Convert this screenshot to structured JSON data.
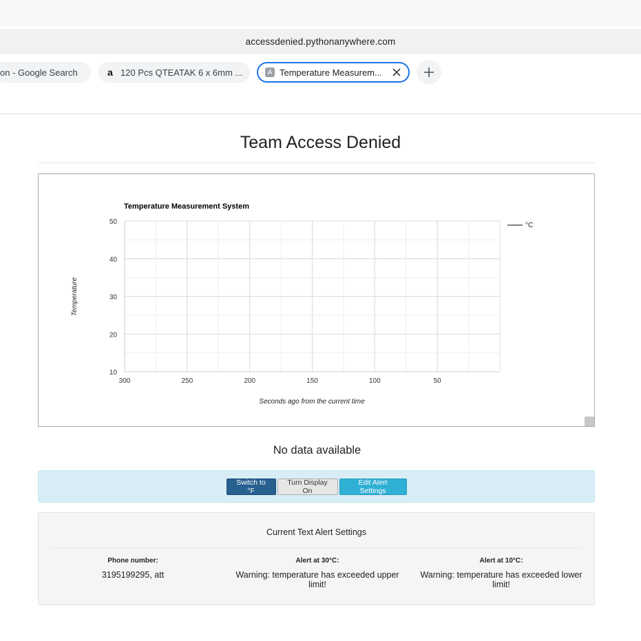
{
  "browser": {
    "url": "accessdenied.pythonanywhere.com",
    "tabs": [
      {
        "label": "on - Google Search",
        "active": false
      },
      {
        "label": "120 Pcs QTEATAK 6 x 6mm ...",
        "active": false,
        "favicon": "amazon-icon"
      },
      {
        "label": "Temperature Measurem...",
        "active": true,
        "favicon": "A"
      }
    ]
  },
  "page": {
    "title": "Team Access Denied",
    "status": "No data available"
  },
  "chart_data": {
    "type": "line",
    "title": "Temperature Measurement System",
    "xlabel": "Seconds ago from the current time",
    "ylabel": "Temperature",
    "x_ticks": [
      300,
      250,
      200,
      150,
      100,
      50
    ],
    "y_ticks": [
      50,
      40,
      30,
      20,
      10
    ],
    "xlim": [
      300,
      0
    ],
    "ylim": [
      10,
      50
    ],
    "grid": true,
    "legend_position": "top-right",
    "series": [
      {
        "name": "°C",
        "values": []
      }
    ]
  },
  "controls": {
    "switch_unit": "Switch to °F",
    "display_toggle": "Turn Display On",
    "edit_alerts": "Edit Alert Settings"
  },
  "alerts": {
    "title": "Current Text Alert Settings",
    "columns": [
      {
        "header": "Phone number:",
        "value": "3195199295, att"
      },
      {
        "header": "Alert at 30°C:",
        "value": "Warning: temperature has exceeded upper limit!"
      },
      {
        "header": "Alert at 10°C:",
        "value": "Warning: temperature has exceeded lower limit!"
      }
    ]
  }
}
